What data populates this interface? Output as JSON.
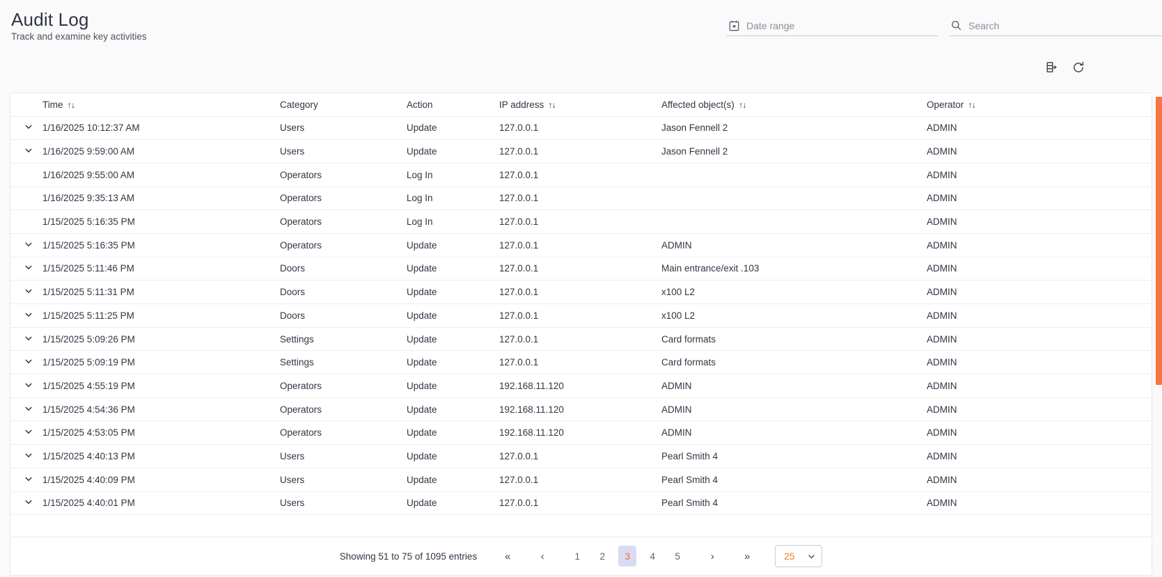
{
  "header": {
    "title": "Audit Log",
    "subtitle": "Track and examine key activities",
    "date_range": {
      "placeholder": "Date range",
      "value": "",
      "icon": "calendar-icon"
    },
    "search": {
      "placeholder": "Search",
      "value": "",
      "icon": "search-icon"
    },
    "export_icon": "export-file-add-icon",
    "refresh_icon": "refresh-icon"
  },
  "table": {
    "columns": [
      {
        "label": "",
        "sortable": false
      },
      {
        "label": "Time",
        "sortable": true
      },
      {
        "label": "Category",
        "sortable": false
      },
      {
        "label": "Action",
        "sortable": false
      },
      {
        "label": "IP address",
        "sortable": true
      },
      {
        "label": "Affected object(s)",
        "sortable": true
      },
      {
        "label": "Operator",
        "sortable": true
      }
    ],
    "sort_glyph": "↑↓",
    "rows": [
      {
        "expandable": true,
        "time": "1/16/2025 10:12:37 AM",
        "category": "Users",
        "action": "Update",
        "ip": "127.0.0.1",
        "object": "Jason Fennell 2",
        "operator": "ADMIN"
      },
      {
        "expandable": true,
        "time": "1/16/2025 9:59:00 AM",
        "category": "Users",
        "action": "Update",
        "ip": "127.0.0.1",
        "object": "Jason Fennell 2",
        "operator": "ADMIN"
      },
      {
        "expandable": false,
        "time": "1/16/2025 9:55:00 AM",
        "category": "Operators",
        "action": "Log In",
        "ip": "127.0.0.1",
        "object": "",
        "operator": "ADMIN"
      },
      {
        "expandable": false,
        "time": "1/16/2025 9:35:13 AM",
        "category": "Operators",
        "action": "Log In",
        "ip": "127.0.0.1",
        "object": "",
        "operator": "ADMIN"
      },
      {
        "expandable": false,
        "time": "1/15/2025 5:16:35 PM",
        "category": "Operators",
        "action": "Log In",
        "ip": "127.0.0.1",
        "object": "",
        "operator": "ADMIN"
      },
      {
        "expandable": true,
        "time": "1/15/2025 5:16:35 PM",
        "category": "Operators",
        "action": "Update",
        "ip": "127.0.0.1",
        "object": "ADMIN",
        "operator": "ADMIN"
      },
      {
        "expandable": true,
        "time": "1/15/2025 5:11:46 PM",
        "category": "Doors",
        "action": "Update",
        "ip": "127.0.0.1",
        "object": "Main entrance/exit .103",
        "operator": "ADMIN"
      },
      {
        "expandable": true,
        "time": "1/15/2025 5:11:31 PM",
        "category": "Doors",
        "action": "Update",
        "ip": "127.0.0.1",
        "object": "x100 L2",
        "operator": "ADMIN"
      },
      {
        "expandable": true,
        "time": "1/15/2025 5:11:25 PM",
        "category": "Doors",
        "action": "Update",
        "ip": "127.0.0.1",
        "object": "x100 L2",
        "operator": "ADMIN"
      },
      {
        "expandable": true,
        "time": "1/15/2025 5:09:26 PM",
        "category": "Settings",
        "action": "Update",
        "ip": "127.0.0.1",
        "object": "Card formats",
        "operator": "ADMIN"
      },
      {
        "expandable": true,
        "time": "1/15/2025 5:09:19 PM",
        "category": "Settings",
        "action": "Update",
        "ip": "127.0.0.1",
        "object": "Card formats",
        "operator": "ADMIN"
      },
      {
        "expandable": true,
        "time": "1/15/2025 4:55:19 PM",
        "category": "Operators",
        "action": "Update",
        "ip": "192.168.11.120",
        "object": "ADMIN",
        "operator": "ADMIN"
      },
      {
        "expandable": true,
        "time": "1/15/2025 4:54:36 PM",
        "category": "Operators",
        "action": "Update",
        "ip": "192.168.11.120",
        "object": "ADMIN",
        "operator": "ADMIN"
      },
      {
        "expandable": true,
        "time": "1/15/2025 4:53:05 PM",
        "category": "Operators",
        "action": "Update",
        "ip": "192.168.11.120",
        "object": "ADMIN",
        "operator": "ADMIN"
      },
      {
        "expandable": true,
        "time": "1/15/2025 4:40:13 PM",
        "category": "Users",
        "action": "Update",
        "ip": "127.0.0.1",
        "object": "Pearl Smith 4",
        "operator": "ADMIN"
      },
      {
        "expandable": true,
        "time": "1/15/2025 4:40:09 PM",
        "category": "Users",
        "action": "Update",
        "ip": "127.0.0.1",
        "object": "Pearl Smith 4",
        "operator": "ADMIN"
      },
      {
        "expandable": true,
        "time": "1/15/2025 4:40:01 PM",
        "category": "Users",
        "action": "Update",
        "ip": "127.0.0.1",
        "object": "Pearl Smith 4",
        "operator": "ADMIN"
      }
    ]
  },
  "pagination": {
    "showing": "Showing 51 to 75 of 1095 entries",
    "first_glyph": "«",
    "prev_glyph": "‹",
    "next_glyph": "›",
    "last_glyph": "»",
    "pages": [
      "1",
      "2",
      "3",
      "4",
      "5"
    ],
    "active_page": "3",
    "page_size": "25"
  },
  "colors": {
    "accent_orange": "#f97544",
    "active_page_bg": "#d9daf4",
    "active_page_text": "#f1693c",
    "page_size_text": "#e8832f"
  }
}
